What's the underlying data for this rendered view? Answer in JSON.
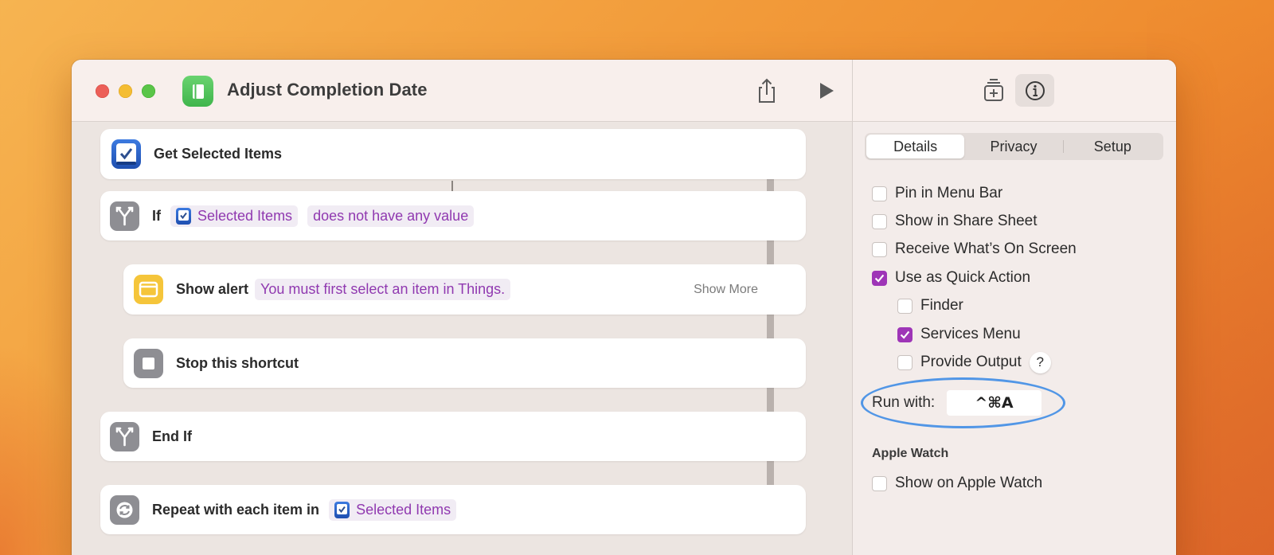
{
  "window": {
    "title": "Adjust Completion Date"
  },
  "actions": {
    "get_selected": {
      "label": "Get Selected Items"
    },
    "if_block": {
      "label": "If",
      "variable": "Selected Items",
      "condition": "does not have any value"
    },
    "show_alert": {
      "label": "Show alert",
      "message": "You must first select an item in Things.",
      "show_more": "Show More"
    },
    "stop": {
      "label": "Stop this shortcut"
    },
    "end_if": {
      "label": "End If"
    },
    "repeat": {
      "label": "Repeat with each item in",
      "variable": "Selected Items"
    }
  },
  "panel": {
    "tabs": [
      {
        "label": "Details",
        "active": true
      },
      {
        "label": "Privacy",
        "active": false
      },
      {
        "label": "Setup",
        "active": false
      }
    ],
    "options": [
      {
        "label": "Pin in Menu Bar",
        "checked": false
      },
      {
        "label": "Show in Share Sheet",
        "checked": false
      },
      {
        "label": "Receive What’s On Screen",
        "checked": false
      },
      {
        "label": "Use as Quick Action",
        "checked": true
      },
      {
        "label": "Finder",
        "checked": false
      },
      {
        "label": "Services Menu",
        "checked": true
      },
      {
        "label": "Provide Output",
        "checked": false
      }
    ],
    "help_glyph": "?",
    "run_with_label": "Run with:",
    "run_with_value": "^⌘A",
    "apple_watch_heading": "Apple Watch",
    "apple_watch_option": {
      "label": "Show on Apple Watch",
      "checked": false
    }
  },
  "colors": {
    "accent_purple": "#9e35b7",
    "variable_text": "#9039b0",
    "highlight_blue": "#5196e6"
  }
}
